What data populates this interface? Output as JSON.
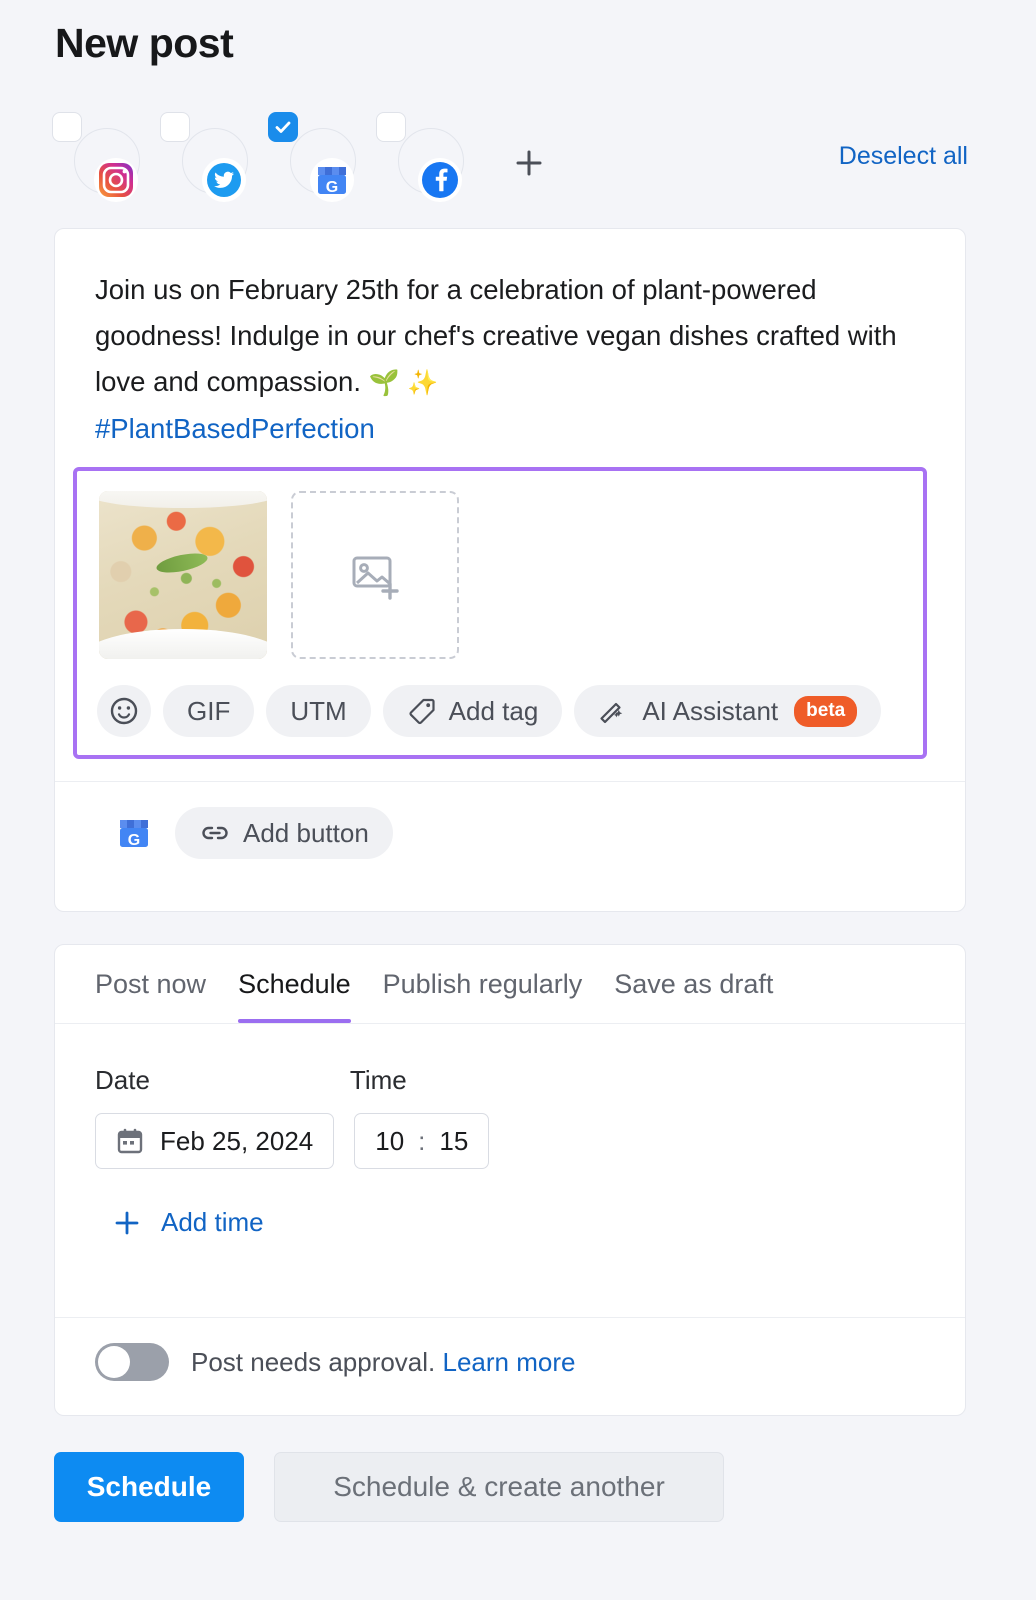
{
  "header": {
    "title": "New post",
    "deselect_all": "Deselect all",
    "add_account_icon": "plus-icon"
  },
  "accounts": [
    {
      "name": "instagram",
      "icon": "instagram-icon",
      "checked": false
    },
    {
      "name": "twitter",
      "icon": "twitter-icon",
      "checked": false
    },
    {
      "name": "google-business-profile",
      "icon": "google-business-profile-icon",
      "checked": true
    },
    {
      "name": "facebook",
      "icon": "facebook-icon",
      "checked": false
    }
  ],
  "composer": {
    "text_line_1": "Join us on February 25th for a celebration of plant-powered goodness! Indulge in our chef's creative vegan dishes crafted with love and compassion. ",
    "emoji_seedling": "🌱",
    "emoji_sparkles": "✨",
    "hashtag": "#PlantBasedPerfection",
    "media": {
      "attached_image_alt": "couscous-vegetable-salad",
      "add_media_icon": "add-image-icon"
    },
    "toolbar": [
      {
        "name": "emoji",
        "label": "",
        "icon": "emoji-icon"
      },
      {
        "name": "gif",
        "label": "GIF",
        "icon": ""
      },
      {
        "name": "utm",
        "label": "UTM",
        "icon": ""
      },
      {
        "name": "add-tag",
        "label": "Add tag",
        "icon": "tag-icon"
      },
      {
        "name": "ai-assistant",
        "label": "AI Assistant",
        "icon": "magic-wand-icon",
        "badge": "beta"
      }
    ],
    "button_row": {
      "platform_icon": "google-business-profile-icon",
      "add_button_label": "Add button",
      "add_button_icon": "link-icon"
    },
    "highlight_color": "#a872f3"
  },
  "schedule": {
    "tabs": [
      {
        "label": "Post now",
        "active": false
      },
      {
        "label": "Schedule",
        "active": true
      },
      {
        "label": "Publish regularly",
        "active": false
      },
      {
        "label": "Save as draft",
        "active": false
      }
    ],
    "date_label": "Date",
    "time_label": "Time",
    "date_value": "Feb 25, 2024",
    "date_icon": "calendar-icon",
    "time_hours": "10",
    "time_separator": ":",
    "time_minutes": "15",
    "add_time_label": "Add time",
    "add_time_icon": "plus-icon",
    "approval_toggle_on": false,
    "approval_text": "Post needs approval.",
    "approval_link": "Learn more",
    "active_tab_color": "#9b6ef0"
  },
  "footer": {
    "primary_label": "Schedule",
    "secondary_label": "Schedule & create another",
    "primary_color": "#0d8bf2"
  }
}
